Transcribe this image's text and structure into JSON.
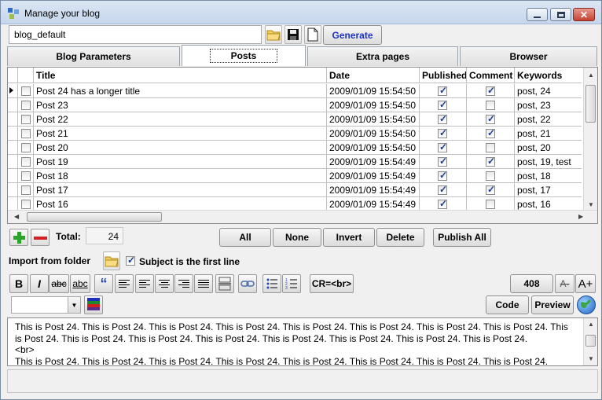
{
  "window": {
    "title": "Manage your blog",
    "controls": [
      "minimize",
      "maximize",
      "close"
    ]
  },
  "toolbar": {
    "blog_name": "blog_default",
    "generate_label": "Generate",
    "icons": [
      "folder-open-icon",
      "save-icon",
      "new-document-icon"
    ]
  },
  "tabs": [
    {
      "label": "Blog Parameters",
      "active": false
    },
    {
      "label": "Posts",
      "active": true
    },
    {
      "label": "Extra pages",
      "active": false
    },
    {
      "label": "Browser",
      "active": false
    }
  ],
  "grid": {
    "columns": [
      "Title",
      "Date",
      "Published",
      "Comment",
      "Keywords"
    ],
    "rows": [
      {
        "title": "Post 24 has a longer title",
        "date": "2009/01/09 15:54:50",
        "published": true,
        "comment": true,
        "keywords": "post, 24",
        "current": true
      },
      {
        "title": "Post 23",
        "date": "2009/01/09 15:54:50",
        "published": true,
        "comment": false,
        "keywords": "post, 23"
      },
      {
        "title": "Post 22",
        "date": "2009/01/09 15:54:50",
        "published": true,
        "comment": true,
        "keywords": "post, 22"
      },
      {
        "title": "Post 21",
        "date": "2009/01/09 15:54:50",
        "published": true,
        "comment": true,
        "keywords": "post, 21"
      },
      {
        "title": "Post 20",
        "date": "2009/01/09 15:54:50",
        "published": true,
        "comment": false,
        "keywords": "post, 20"
      },
      {
        "title": "Post 19",
        "date": "2009/01/09 15:54:49",
        "published": true,
        "comment": true,
        "keywords": "post, 19, test"
      },
      {
        "title": "Post 18",
        "date": "2009/01/09 15:54:49",
        "published": true,
        "comment": false,
        "keywords": "post, 18"
      },
      {
        "title": "Post 17",
        "date": "2009/01/09 15:54:49",
        "published": true,
        "comment": true,
        "keywords": "post, 17"
      },
      {
        "title": "Post 16",
        "date": "2009/01/09 15:54:49",
        "published": true,
        "comment": false,
        "keywords": "post, 16"
      }
    ]
  },
  "actions": {
    "total_label": "Total:",
    "total_value": "24",
    "all": "All",
    "none": "None",
    "invert": "Invert",
    "delete": "Delete",
    "publish_all": "Publish All"
  },
  "import": {
    "label": "Import from folder",
    "subject_checkbox_label": "Subject is the first line",
    "subject_checked": true
  },
  "formatting": {
    "bold": "B",
    "italic": "I",
    "strike": "abc",
    "underline": "abc",
    "quote": "“",
    "cr_br": "CR=<br>",
    "char_count": "408",
    "font_smaller": "A-",
    "font_larger": "A+",
    "code": "Code",
    "preview": "Preview",
    "font_select_value": ""
  },
  "editor": {
    "content": "This is Post 24. This is Post 24. This is Post 24. This is Post 24. This is Post 24. This is Post 24. This is Post 24. This is Post 24. This is Post 24. This is Post 24. This is Post 24. This is Post 24. This is Post 24. This is Post 24. This is Post 24. This is Post 24.\n<br>\nThis is Post 24. This is Post 24. This is Post 24. This is Post 24. This is Post 24. This is Post 24. This is Post 24. This is Post 24."
  },
  "colors": {
    "title_gradient_top": "#dbe6f4",
    "generate_text": "#1c32c8",
    "add_green": "#29a329",
    "remove_red": "#d42020",
    "check_blue": "#1a3d8a"
  }
}
